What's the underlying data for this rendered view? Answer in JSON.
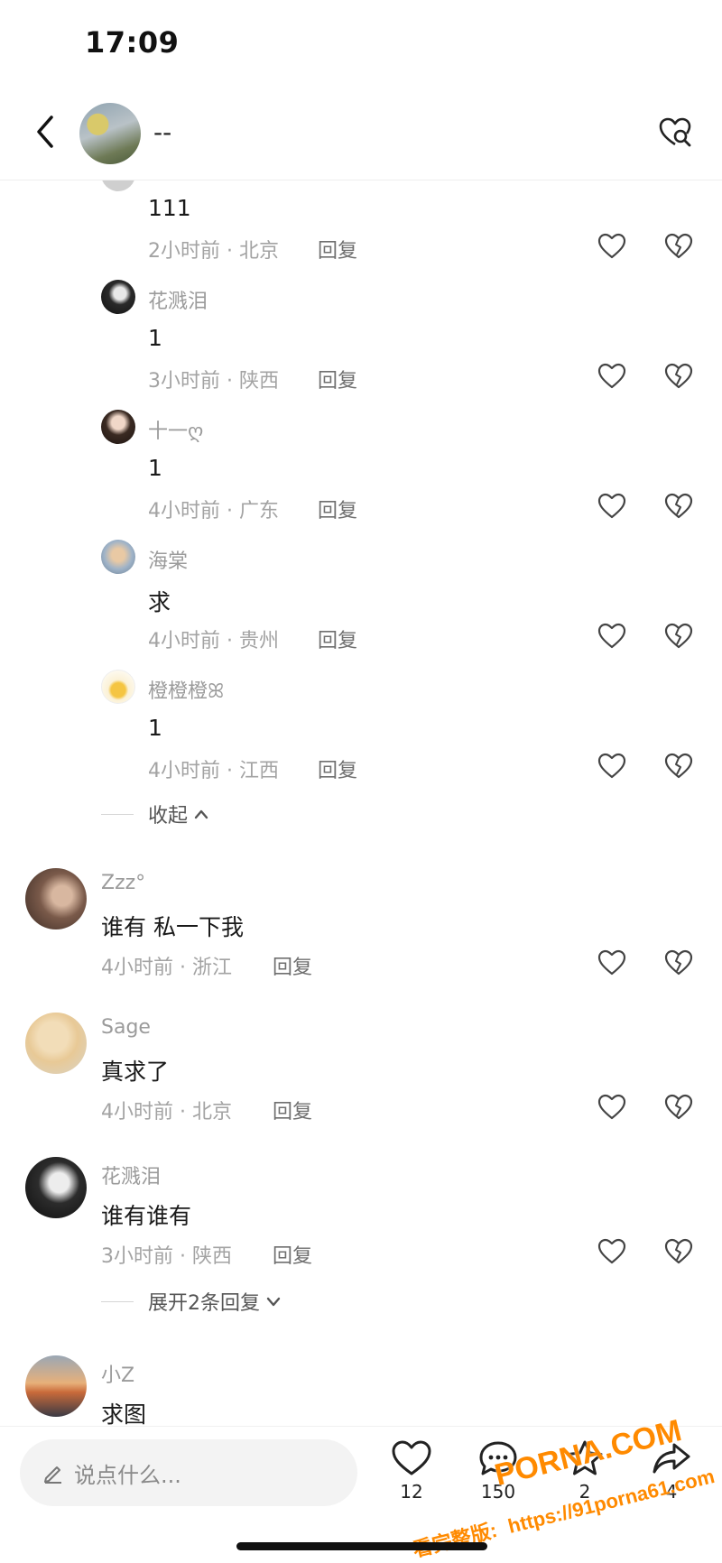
{
  "status_bar": {
    "time": "17:09"
  },
  "header": {
    "title": "--",
    "back_icon": "chevron-left-icon",
    "action_icon": "search-heart-icon"
  },
  "comments": {
    "reply_label": "回复",
    "top_reply": {
      "text": "111",
      "meta": "2小时前 · 北京"
    },
    "replies": [
      {
        "name": "花溅泪",
        "text": "1",
        "meta": "3小时前 · 陕西"
      },
      {
        "name": "十一ღ",
        "text": "1",
        "meta": "4小时前 · 广东"
      },
      {
        "name": "海棠",
        "text": "求",
        "meta": "4小时前 · 贵州"
      },
      {
        "name": "橙橙橙ꕤ",
        "text": "1",
        "meta": "4小时前 · 江西"
      }
    ],
    "collapse_label": "收起",
    "items": [
      {
        "name": "Zzz°",
        "text": "谁有 私一下我",
        "meta": "4小时前 · 浙江"
      },
      {
        "name": "Sage",
        "text": "真求了",
        "meta": "4小时前 · 北京"
      },
      {
        "name": "花溅泪",
        "text": "谁有谁有",
        "meta": "3小时前 · 陕西"
      },
      {
        "name": "小Z",
        "text": "求图"
      }
    ],
    "expand_label": "展开2条回复"
  },
  "bottom_bar": {
    "input_placeholder": "说点什么...",
    "like_count": "12",
    "comment_count": "150",
    "star_count": "2",
    "share_count": "4"
  },
  "watermark": {
    "brand": "PORNA.COM",
    "url": "https://91porna61.com",
    "tagline": "看完整版:"
  }
}
